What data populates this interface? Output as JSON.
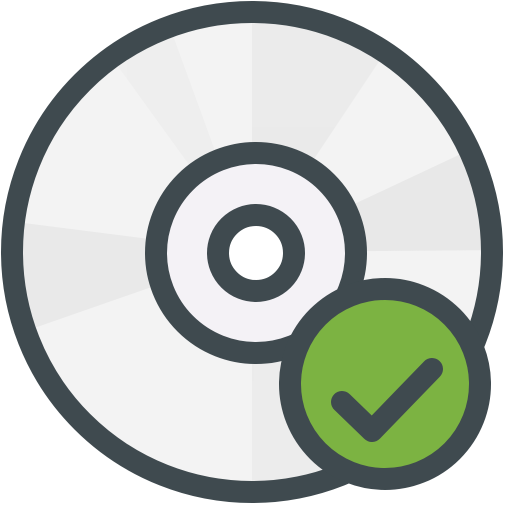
{
  "icon": {
    "main": "disc-icon",
    "badge": "checkmark-icon"
  },
  "colors": {
    "outline": "#3F4A4F",
    "disc_light": "#F2F2F2",
    "disc_shade": "#E4E4E4",
    "badge_green": "#7CB342",
    "badge_green_dark": "#6A9D2E"
  }
}
